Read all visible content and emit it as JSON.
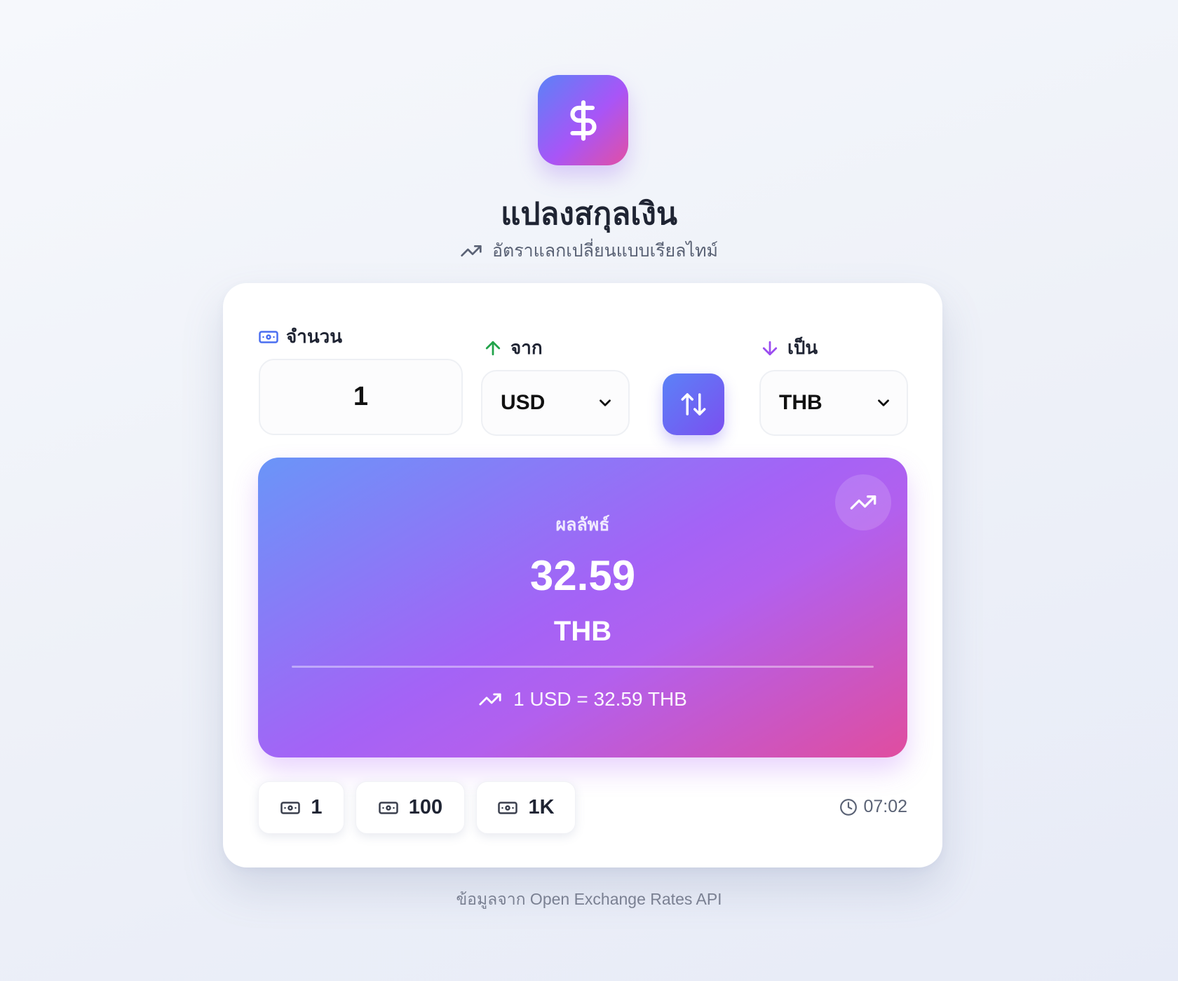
{
  "app": {
    "title": "แปลงสกุลเงิน",
    "subtitle": "อัตราแลกเปลี่ยนแบบเรียลไทม์",
    "logo_icon": "dollar-icon"
  },
  "form": {
    "amount_label": "จำนวน",
    "amount_value": "1",
    "from_label": "จาก",
    "from_value": "USD",
    "to_label": "เป็น",
    "to_value": "THB"
  },
  "result": {
    "label": "ผลลัพธ์",
    "value": "32.59",
    "currency": "THB",
    "rate_text": "1 USD = 32.59 THB"
  },
  "quick_amounts": [
    "1",
    "100",
    "1K"
  ],
  "updated_time": "07:02",
  "footer": "ข้อมูลจาก Open Exchange Rates API",
  "colors": {
    "accent_blue": "#5b82f7",
    "accent_purple": "#a855f7",
    "accent_pink": "#e24fa4",
    "from_arrow": "#22a34a",
    "to_arrow": "#9b4cf0",
    "amount_icon": "#4a6ef0"
  }
}
